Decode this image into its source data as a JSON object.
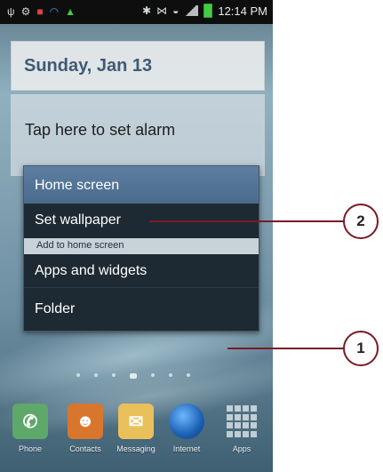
{
  "status_bar": {
    "time": "12:14 PM",
    "left_icons": [
      "usb-icon",
      "settings-icon",
      "antivirus-icon",
      "wifi-icon",
      "android-icon"
    ],
    "right_icons": [
      "bluetooth-icon",
      "nfc-icon",
      "wifi-signal-icon",
      "cell-signal-icon",
      "battery-icon"
    ]
  },
  "widget": {
    "date": "Sunday, Jan 13",
    "alarm": "Tap here to set alarm"
  },
  "context_menu": {
    "title": "Home screen",
    "items": [
      "Set wallpaper",
      "Apps and widgets",
      "Folder"
    ],
    "section_label": "Add to home screen"
  },
  "dock": {
    "apps": [
      {
        "label": "Phone",
        "icon": "phone-icon"
      },
      {
        "label": "Contacts",
        "icon": "contacts-icon"
      },
      {
        "label": "Messaging",
        "icon": "messaging-icon"
      },
      {
        "label": "Internet",
        "icon": "globe-icon"
      },
      {
        "label": "Apps",
        "icon": "apps-grid-icon"
      }
    ]
  },
  "page_indicator": {
    "pages": 7,
    "active": 4
  },
  "callouts": [
    "2",
    "1"
  ],
  "colors": {
    "callout": "#7a1a25",
    "menu_header": "#5d7ea1",
    "menu_bg": "#1e2a33"
  }
}
